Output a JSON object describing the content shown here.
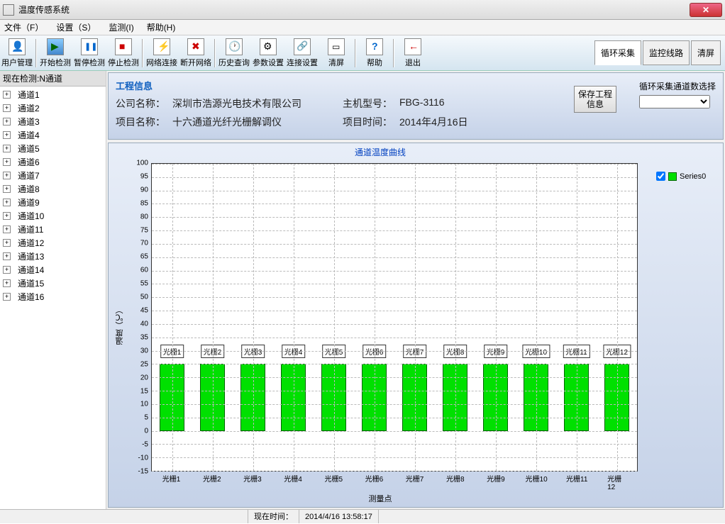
{
  "window": {
    "title": "温度传感系统"
  },
  "menu": {
    "file": "文件（F）",
    "settings": "设置（S）",
    "monitor": "监测(I)",
    "help": "帮助(H)"
  },
  "toolbar": {
    "user": "用户管理",
    "start": "开始检测",
    "pause": "暂停检测",
    "stop": "停止检测",
    "connect": "网络连接",
    "disconnect": "断开网络",
    "history": "历史查询",
    "params": "参数设置",
    "connset": "连接设置",
    "clear": "清屏",
    "helpb": "帮助",
    "exit": "退出"
  },
  "tabs": {
    "cycle": "循环采集",
    "route": "监控线路",
    "clear": "清屏"
  },
  "sidebar": {
    "header": "现在检测:N通道",
    "items": [
      "通道1",
      "通道2",
      "通道3",
      "通道4",
      "通道5",
      "通道6",
      "通道7",
      "通道8",
      "通道9",
      "通道10",
      "通道11",
      "通道12",
      "通道13",
      "通道14",
      "通道15",
      "通道16"
    ]
  },
  "info": {
    "section": "工程信息",
    "company_lbl": "公司名称：",
    "company": "深圳市浩源光电技术有限公司",
    "host_lbl": "主机型号：",
    "host": "FBG-3116",
    "project_lbl": "项目名称：",
    "project": "十六通道光纤光栅解调仪",
    "time_lbl": "项目时间：",
    "time": "2014年4月16日",
    "save_btn": "保存工程信息",
    "chsel_lbl": "循环采集通道数选择"
  },
  "chart_data": {
    "type": "bar",
    "title": "通道温度曲线",
    "ylabel": "温度（℃）",
    "xlabel": "测量点",
    "ylim": [
      -15,
      100
    ],
    "yticks": [
      -15,
      -10,
      -5,
      0,
      5,
      10,
      15,
      20,
      25,
      30,
      35,
      40,
      45,
      50,
      55,
      60,
      65,
      70,
      75,
      80,
      85,
      90,
      95,
      100
    ],
    "categories": [
      "光栅1",
      "光栅2",
      "光栅3",
      "光栅4",
      "光栅5",
      "光栅6",
      "光栅7",
      "光栅8",
      "光栅9",
      "光栅10",
      "光栅11",
      "光栅12"
    ],
    "values": [
      25,
      25,
      25,
      25,
      25,
      25,
      25,
      25,
      25,
      25,
      25,
      25
    ],
    "series_name": "Series0",
    "bar_labels": [
      "光栅1",
      "光栅2",
      "光栅3",
      "光栅4",
      "光栅5",
      "光栅6",
      "光栅7",
      "光栅8",
      "光栅9",
      "光栅10",
      "光栅11",
      "光栅12"
    ]
  },
  "status": {
    "now_lbl": "现在时间：",
    "now": "2014/4/16 13:58:17"
  }
}
